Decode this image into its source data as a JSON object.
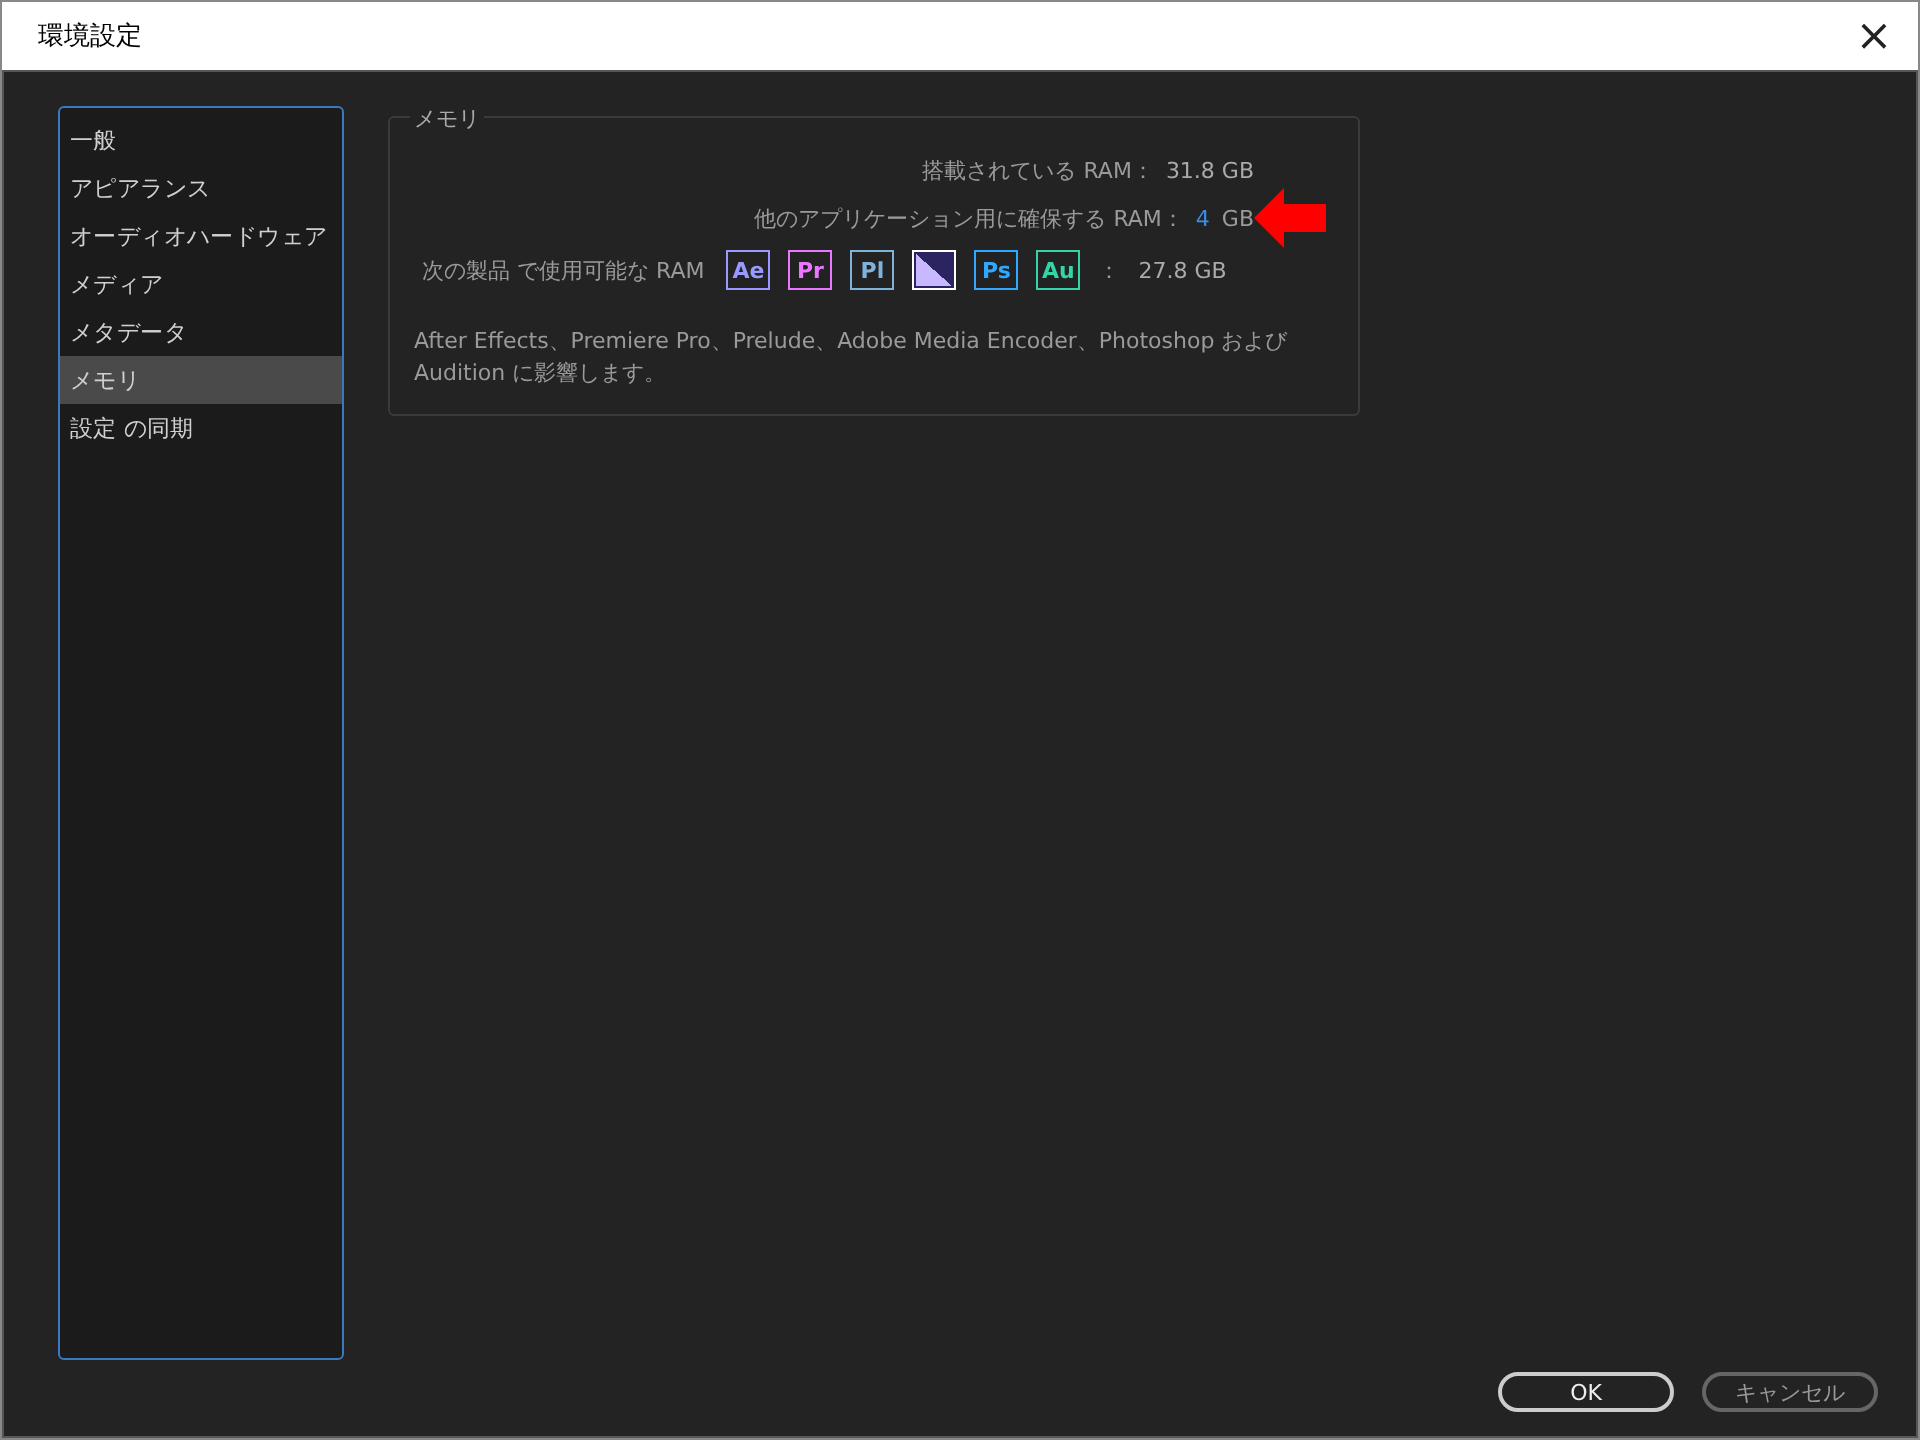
{
  "window": {
    "title": "環境設定",
    "close": "×"
  },
  "sidebar": {
    "items": [
      {
        "label": "一般",
        "selected": false
      },
      {
        "label": "アピアランス",
        "selected": false
      },
      {
        "label": "オーディオハードウェア",
        "selected": false
      },
      {
        "label": "メディア",
        "selected": false
      },
      {
        "label": "メタデータ",
        "selected": false
      },
      {
        "label": "メモリ",
        "selected": true
      },
      {
        "label": "設定 の同期",
        "selected": false
      }
    ]
  },
  "memory": {
    "title": "メモリ",
    "installed": {
      "label": "搭載されている RAM：",
      "value": "31.8 GB"
    },
    "reserved": {
      "label": "他のアプリケーション用に確保する RAM：",
      "value": "4",
      "unit": "GB"
    },
    "available": {
      "label": "次の製品 で使用可能な RAM",
      "separator": "：",
      "value": "27.8 GB",
      "products": [
        {
          "kind": "text",
          "label": "Ae",
          "color": "#9999ff",
          "selected": false
        },
        {
          "kind": "text",
          "label": "Pr",
          "color": "#ea77ff",
          "selected": false
        },
        {
          "kind": "text",
          "label": "Pl",
          "color": "#7fb3d9",
          "selected": false
        },
        {
          "kind": "glyph",
          "color": "#c8b8ff",
          "selected": true
        },
        {
          "kind": "text",
          "label": "Ps",
          "color": "#31a8ff",
          "selected": false
        },
        {
          "kind": "text",
          "label": "Au",
          "color": "#34d4a8",
          "selected": false
        }
      ]
    },
    "note": "After  Effects、Premiere Pro、Prelude、Adobe Media Encoder、Photoshop および Audition に影響します。"
  },
  "buttons": [
    {
      "label": "OK",
      "kind": "primary"
    },
    {
      "label": "キャンセル",
      "kind": "secondary"
    }
  ]
}
